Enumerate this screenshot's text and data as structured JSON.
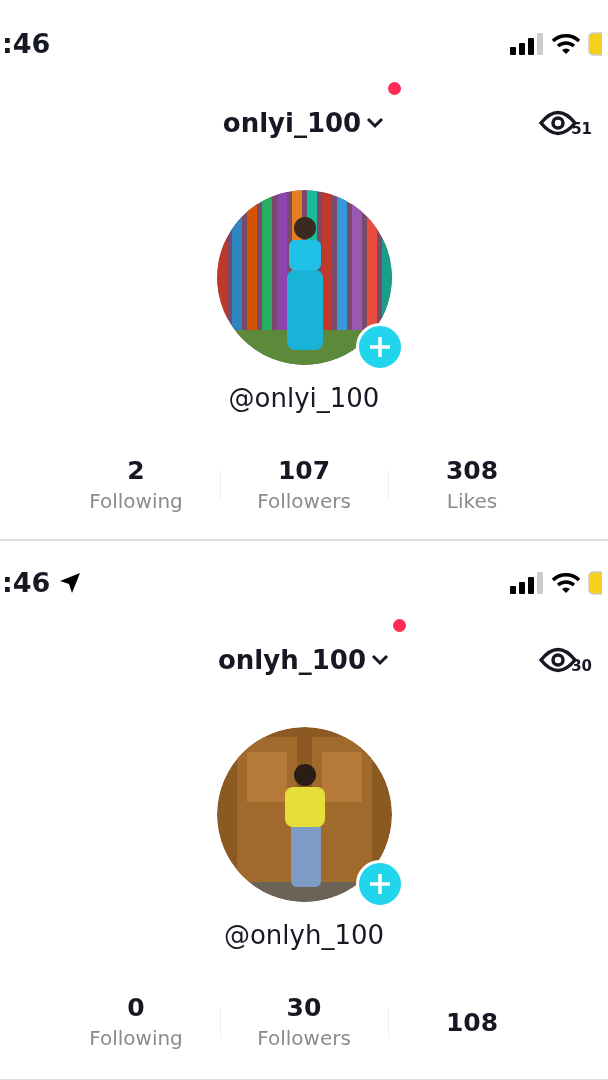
{
  "profiles": [
    {
      "status_bar": {
        "time": ":46",
        "location_arrow": false
      },
      "header": {
        "username": "onlyi_100",
        "notification_dot": true,
        "views": "51"
      },
      "handle": "@onlyi_100",
      "stats": [
        {
          "value": "2",
          "label": "Following"
        },
        {
          "value": "107",
          "label": "Followers"
        },
        {
          "value": "308",
          "label": "Likes"
        }
      ]
    },
    {
      "status_bar": {
        "time": ":46",
        "location_arrow": true
      },
      "header": {
        "username": "onlyh_100",
        "notification_dot": true,
        "views": "30"
      },
      "handle": "@onlyh_100",
      "stats": [
        {
          "value": "0",
          "label": "Following"
        },
        {
          "value": "30",
          "label": "Followers"
        },
        {
          "value": "108"
        }
      ]
    }
  ]
}
